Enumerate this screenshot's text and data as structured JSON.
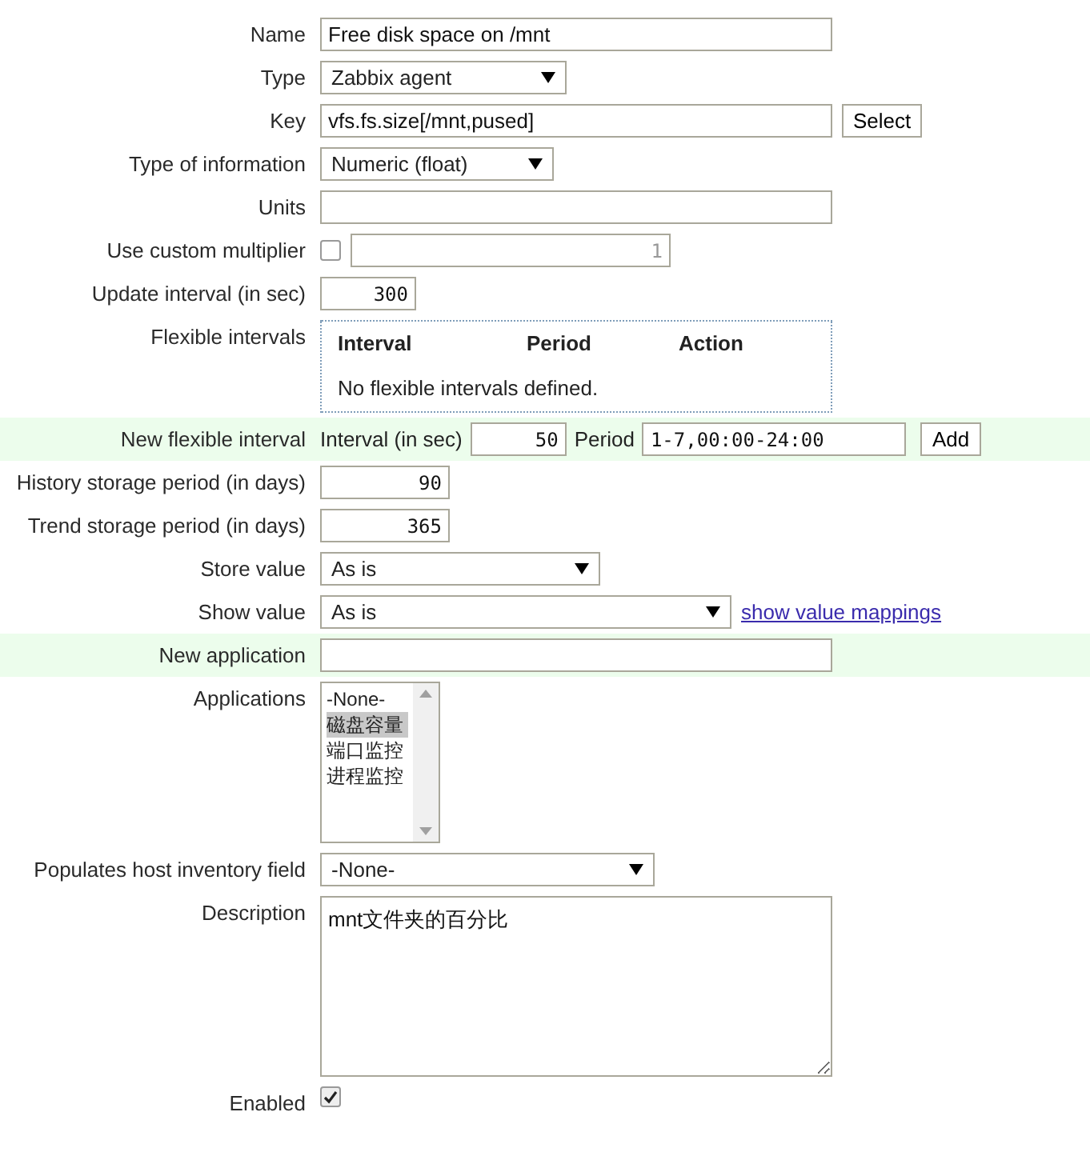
{
  "fields": {
    "name": {
      "label": "Name",
      "value": "Free disk space on /mnt"
    },
    "type": {
      "label": "Type",
      "value": "Zabbix agent"
    },
    "key": {
      "label": "Key",
      "value": "vfs.fs.size[/mnt,pused]",
      "button": "Select"
    },
    "type_of_information": {
      "label": "Type of information",
      "value": "Numeric (float)"
    },
    "units": {
      "label": "Units"
    },
    "custom_multiplier": {
      "label": "Use custom multiplier",
      "checked": false,
      "value": "1",
      "disabled": true
    },
    "update_interval": {
      "label": "Update interval (in sec)",
      "value": "300"
    },
    "flexible_intervals": {
      "label": "Flexible intervals",
      "columns": [
        "Interval",
        "Period",
        "Action"
      ],
      "empty_message": "No flexible intervals defined."
    },
    "new_flexible_interval": {
      "label": "New flexible interval",
      "highlighted": true,
      "interval_label": "Interval (in sec)",
      "interval_value": "50",
      "period_label": "Period",
      "period_value": "1-7,00:00-24:00",
      "button": "Add"
    },
    "history_storage": {
      "label": "History storage period (in days)",
      "value": "90"
    },
    "trend_storage": {
      "label": "Trend storage period (in days)",
      "value": "365"
    },
    "store_value": {
      "label": "Store value",
      "value": "As is"
    },
    "show_value": {
      "label": "Show value",
      "value": "As is",
      "link": "show value mappings"
    },
    "new_application": {
      "label": "New application",
      "highlighted": true
    },
    "applications": {
      "label": "Applications",
      "options": [
        {
          "label": "-None-",
          "selected": false
        },
        {
          "label": "磁盘容量",
          "selected": true
        },
        {
          "label": "端口监控",
          "selected": false
        },
        {
          "label": "进程监控",
          "selected": false
        }
      ]
    },
    "inventory_field": {
      "label": "Populates host inventory field",
      "value": "-None-"
    },
    "description": {
      "label": "Description",
      "value": "mnt文件夹的百分比"
    },
    "enabled": {
      "label": "Enabled",
      "checked": true
    }
  }
}
